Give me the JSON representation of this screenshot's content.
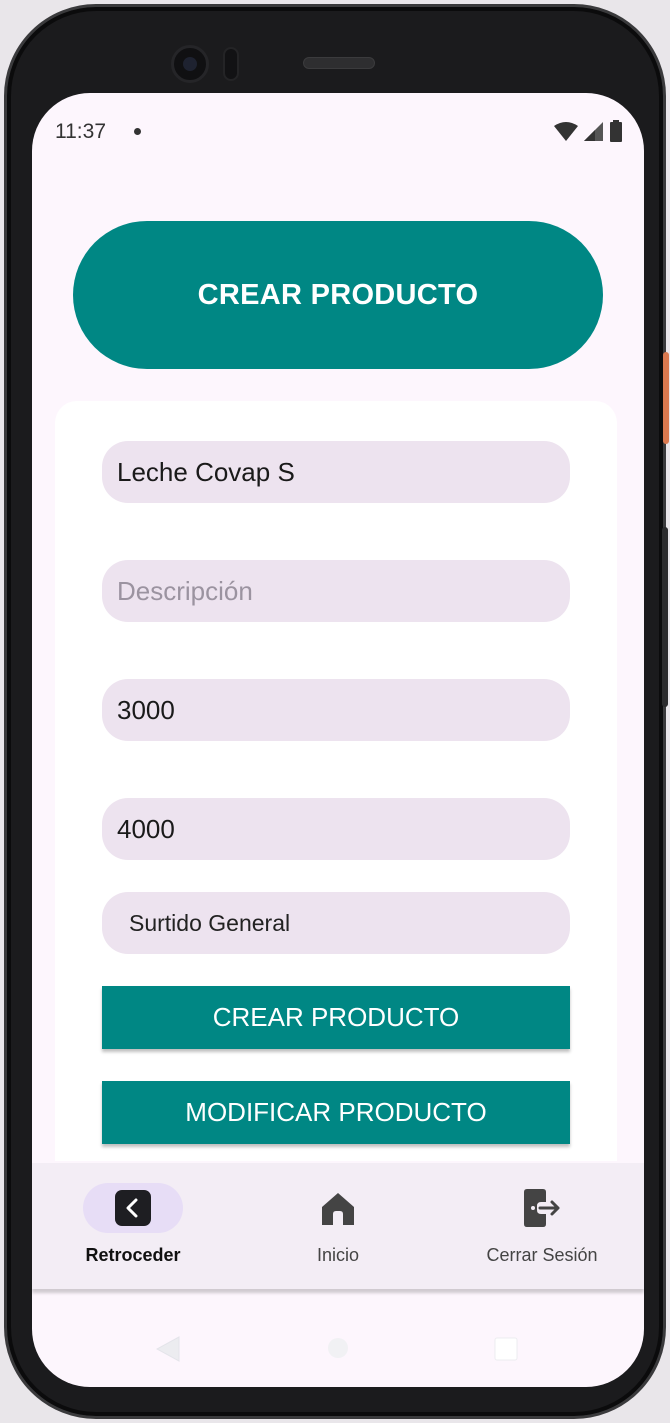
{
  "status_bar": {
    "time": "11:37"
  },
  "header": {
    "title_button_label": "CREAR PRODUCTO"
  },
  "form": {
    "name_value": "Leche Covap S",
    "description_placeholder": "Descripción",
    "price_value": "3000",
    "stock_value": "4000",
    "category_selected": "Surtido General",
    "create_label": "CREAR PRODUCTO",
    "modify_label": "MODIFICAR PRODUCTO"
  },
  "bottom_nav": {
    "items": [
      {
        "label": "Retroceder",
        "icon": "back-icon",
        "active": true
      },
      {
        "label": "Inicio",
        "icon": "home-icon",
        "active": false
      },
      {
        "label": "Cerrar Sesión",
        "icon": "logout-icon",
        "active": false
      }
    ]
  },
  "colors": {
    "primary": "#008784",
    "field_bg": "#ede3ef",
    "screen_bg": "#fdf6fd",
    "nav_active_pill": "#e7ddf6"
  }
}
